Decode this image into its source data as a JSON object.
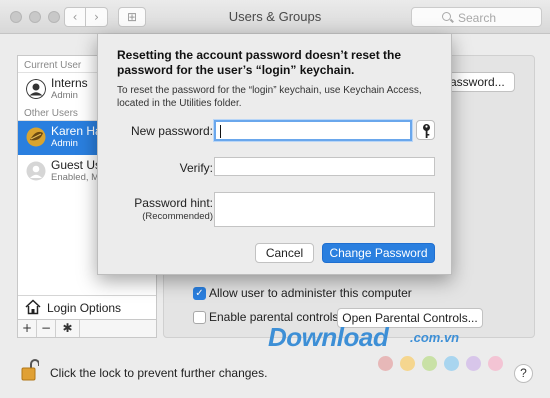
{
  "window": {
    "title": "Users & Groups",
    "search_placeholder": "Search",
    "back_glyph": "‹",
    "forward_glyph": "›",
    "grid_glyph": "⊞"
  },
  "sidebar": {
    "current_user_header": "Current User",
    "other_users_header": "Other Users",
    "users": [
      {
        "name": "Interns",
        "role": "Admin",
        "avatar_icon": "user-silhouette-icon",
        "selected": false
      },
      {
        "name": "Karen Has",
        "role": "Admin",
        "avatar_icon": "leaf-avatar-icon",
        "selected": true
      },
      {
        "name": "Guest Use",
        "role": "Enabled, M",
        "avatar_icon": "guest-avatar-icon",
        "selected": false
      }
    ],
    "login_options_label": "Login Options",
    "add_glyph": "+",
    "remove_glyph": "−",
    "gear_glyph": "✱"
  },
  "panel": {
    "change_password_partial": "assword...",
    "allow_admin_label": "Allow user to administer this computer",
    "allow_admin_checked": true,
    "parental_controls_label": "Enable parental controls",
    "parental_controls_checked": false,
    "open_parental_label": "Open Parental Controls..."
  },
  "footer": {
    "lock_label": "Click the lock to prevent further changes.",
    "help_glyph": "?"
  },
  "watermark": {
    "text": "Download",
    "domain": ".com.vn",
    "dot_colors": [
      "#e7b8b8",
      "#f5d68f",
      "#c9e1a6",
      "#a9d5ef",
      "#d8c6ea",
      "#f3c4d4"
    ]
  },
  "dialog": {
    "title": "Resetting the account password doesn’t reset the password for the user’s “login” keychain.",
    "body": "To reset the password for the “login” keychain, use Keychain Access, located in the Utilities folder.",
    "new_password_label": "New password:",
    "new_password_value": "",
    "verify_label": "Verify:",
    "verify_value": "",
    "hint_label": "Password hint:",
    "hint_sub": "(Recommended)",
    "hint_value": "",
    "cancel_label": "Cancel",
    "confirm_label": "Change Password",
    "accent": "#2a7fdf"
  }
}
